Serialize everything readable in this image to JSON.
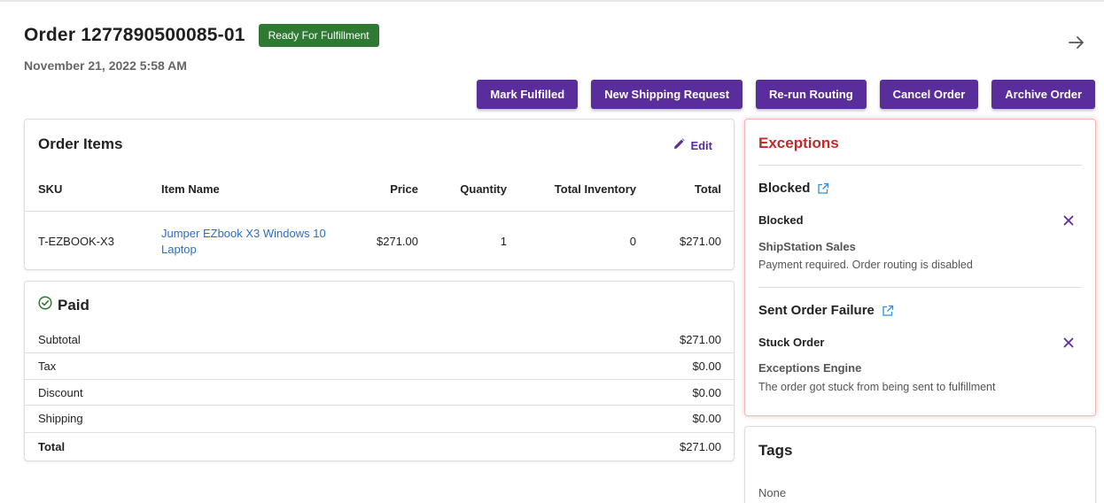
{
  "header": {
    "title": "Order 1277890500085-01",
    "status_badge": "Ready For Fulfillment",
    "date": "November 21, 2022 5:58 AM"
  },
  "actions": [
    {
      "label": "Mark Fulfilled"
    },
    {
      "label": "New Shipping Request"
    },
    {
      "label": "Re-run Routing"
    },
    {
      "label": "Cancel Order"
    },
    {
      "label": "Archive Order"
    }
  ],
  "order_items": {
    "title": "Order Items",
    "edit_label": "Edit",
    "columns": {
      "sku": "SKU",
      "item_name": "Item Name",
      "price": "Price",
      "quantity": "Quantity",
      "total_inventory": "Total Inventory",
      "total": "Total"
    },
    "rows": [
      {
        "sku": "T-EZBOOK-X3",
        "item_name": "Jumper EZbook X3 Windows 10 Laptop",
        "price": "$271.00",
        "quantity": "1",
        "total_inventory": "0",
        "total": "$271.00"
      }
    ]
  },
  "payment": {
    "status": "Paid",
    "rows": [
      {
        "label": "Subtotal",
        "value": "$271.00"
      },
      {
        "label": "Tax",
        "value": "$0.00"
      },
      {
        "label": "Discount",
        "value": "$0.00"
      },
      {
        "label": "Shipping",
        "value": "$0.00"
      },
      {
        "label": "Total",
        "value": "$271.00"
      }
    ]
  },
  "exceptions": {
    "title": "Exceptions",
    "groups": [
      {
        "name": "Blocked",
        "items": [
          {
            "name": "Blocked",
            "source": "ShipStation Sales",
            "message": "Payment required. Order routing is disabled"
          }
        ]
      },
      {
        "name": "Sent Order Failure",
        "items": [
          {
            "name": "Stuck Order",
            "source": "Exceptions Engine",
            "message": "The order got stuck from being sent to fulfillment"
          }
        ]
      }
    ]
  },
  "tags": {
    "title": "Tags",
    "value": "None"
  },
  "colors": {
    "primary": "#5a2d9c",
    "status_green": "#2f7a32",
    "danger": "#c62828",
    "link": "#2d6fc4"
  },
  "icons": {
    "forward": "arrow-right-icon",
    "edit": "pencil-icon",
    "paid": "check-circle-icon",
    "external": "external-link-icon",
    "dismiss": "close-icon"
  }
}
